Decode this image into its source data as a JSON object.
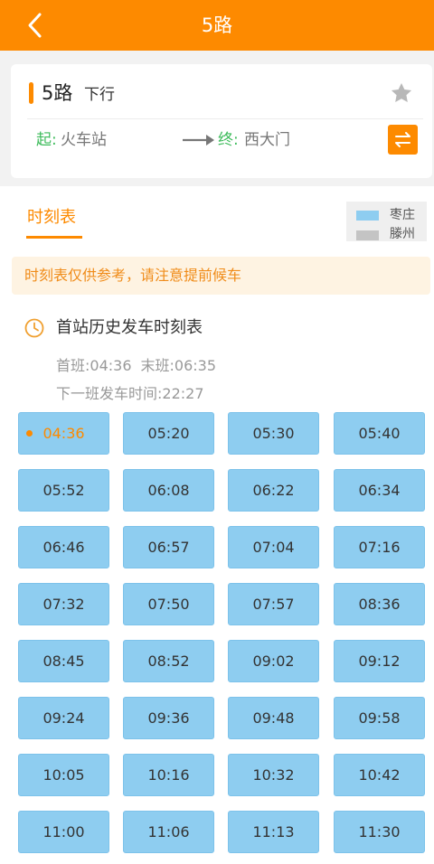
{
  "header": {
    "title": "5路"
  },
  "route": {
    "name": "5路",
    "direction": "下行",
    "start_label": "起:",
    "start_name": "火车站",
    "end_label": "终:",
    "end_name": "西大门"
  },
  "tabs": {
    "timetable": "时刻表"
  },
  "legend": [
    {
      "label": "枣庄",
      "color": "#8ecdf0"
    },
    {
      "label": "滕州",
      "color": "#c4c4c4"
    }
  ],
  "notice": "时刻表仅供参考，请注意提前候车",
  "section": {
    "title": "首站历史发车时刻表",
    "first_label": "首班:",
    "first_time": "04:36",
    "last_label": "末班:",
    "last_time": "06:35",
    "next_label": "下一班发车时间:",
    "next_time": "22:27"
  },
  "colors": {
    "accent": "#fd8a00",
    "time_cell": "#8ecdf0",
    "start_green": "#3dbb5b"
  },
  "current_index": 0,
  "times": [
    "04:36",
    "05:20",
    "05:30",
    "05:40",
    "05:52",
    "06:08",
    "06:22",
    "06:34",
    "06:46",
    "06:57",
    "07:04",
    "07:16",
    "07:32",
    "07:50",
    "07:57",
    "08:36",
    "08:45",
    "08:52",
    "09:02",
    "09:12",
    "09:24",
    "09:36",
    "09:48",
    "09:58",
    "10:05",
    "10:16",
    "10:32",
    "10:42",
    "11:00",
    "11:06",
    "11:13",
    "11:30"
  ]
}
